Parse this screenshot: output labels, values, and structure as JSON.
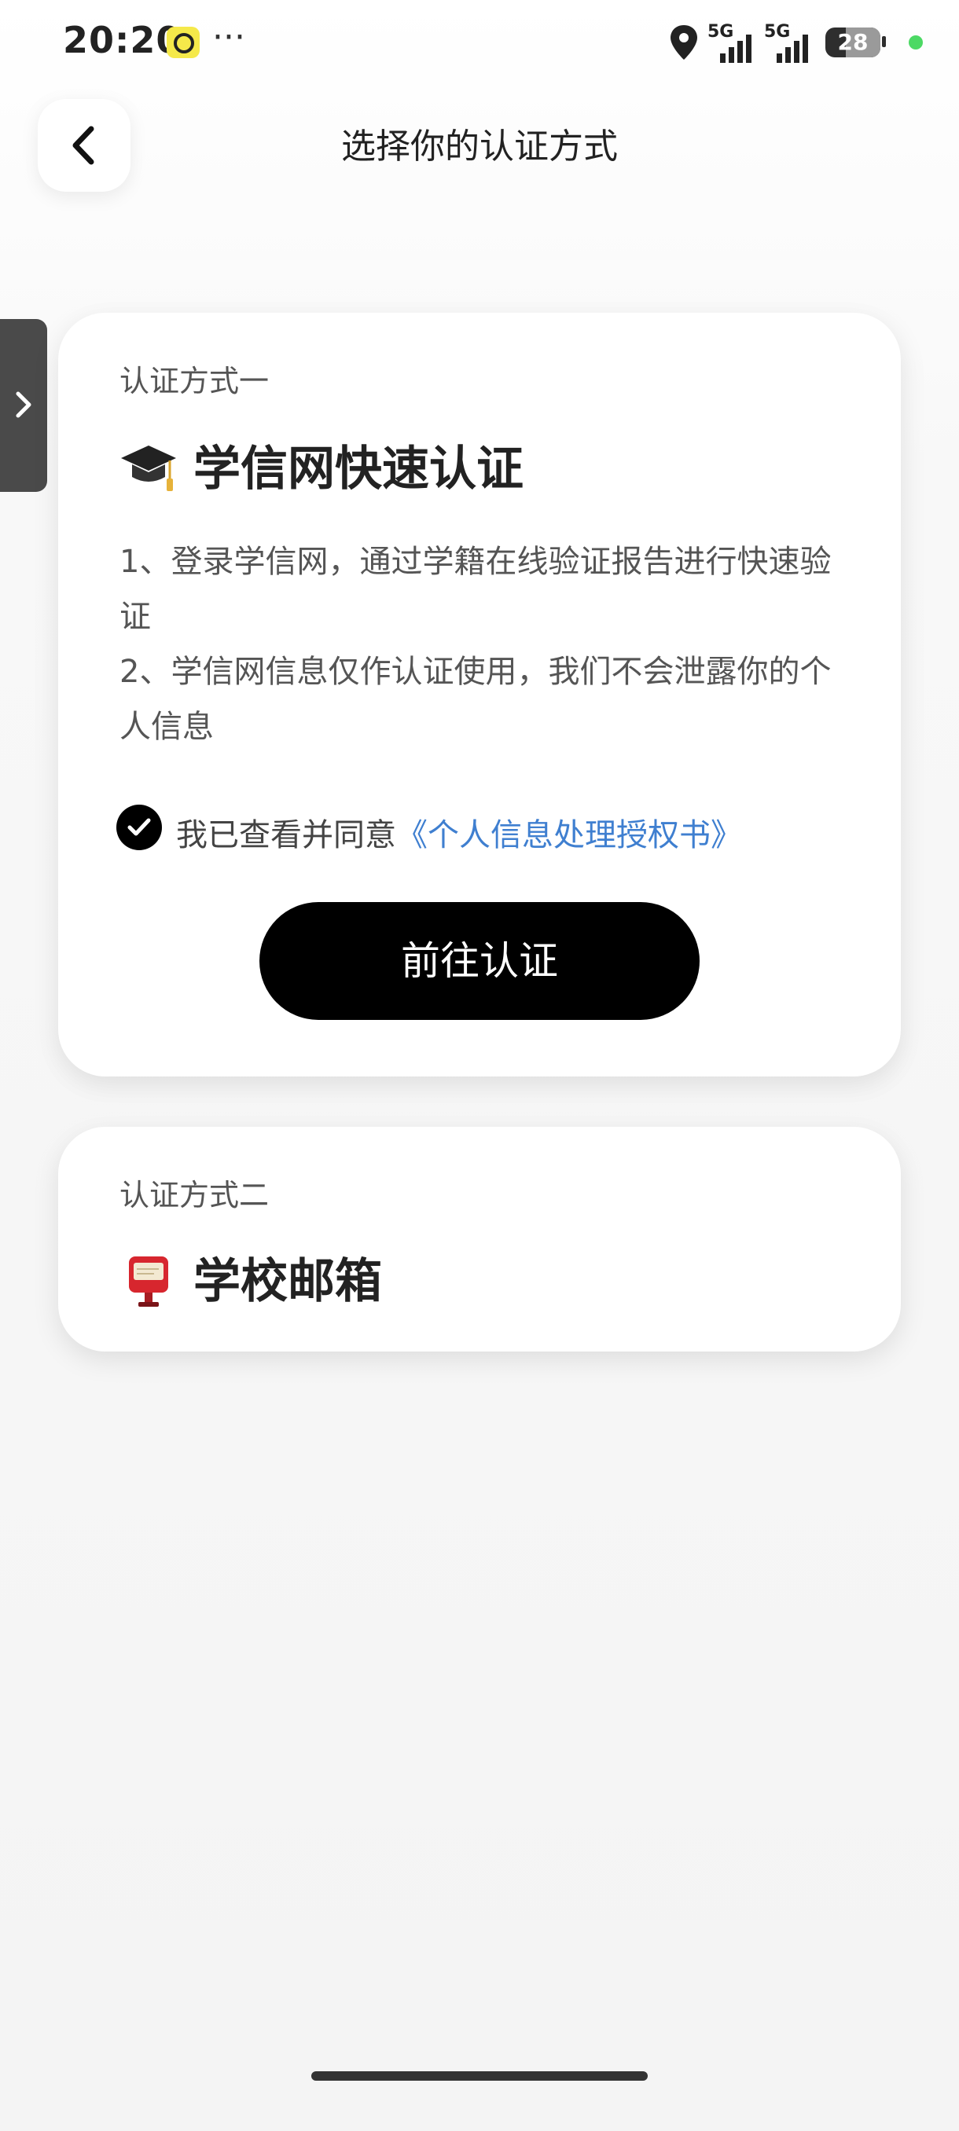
{
  "status_bar": {
    "time": "20:20",
    "more": "···",
    "signal_1_label": "5G",
    "signal_2_label": "5G",
    "battery": "28",
    "icons": [
      "app-badge-icon",
      "location-icon",
      "signal-icon",
      "battery-icon"
    ],
    "dot_color": "#4cd964"
  },
  "nav": {
    "title": "选择你的认证方式",
    "back_icon": "chevron-left-icon"
  },
  "side_tab": {
    "icon": "chevron-right-icon"
  },
  "method1": {
    "label": "认证方式一",
    "icon": "graduation-cap-icon",
    "title": "学信网快速认证",
    "desc_line1": "1、登录学信网，通过学籍在线验证报告进行快速验证",
    "desc_line2": "2、学信网信息仅作认证使用，我们不会泄露你的个人信息",
    "agree_prefix": "我已查看并同意",
    "agree_link": "《个人信息处理授权书》",
    "agree_checked": true,
    "button": "前往认证",
    "link_color": "#3f7fd0"
  },
  "method2": {
    "label": "认证方式二",
    "icon": "postbox-icon",
    "title": "学校邮箱"
  }
}
